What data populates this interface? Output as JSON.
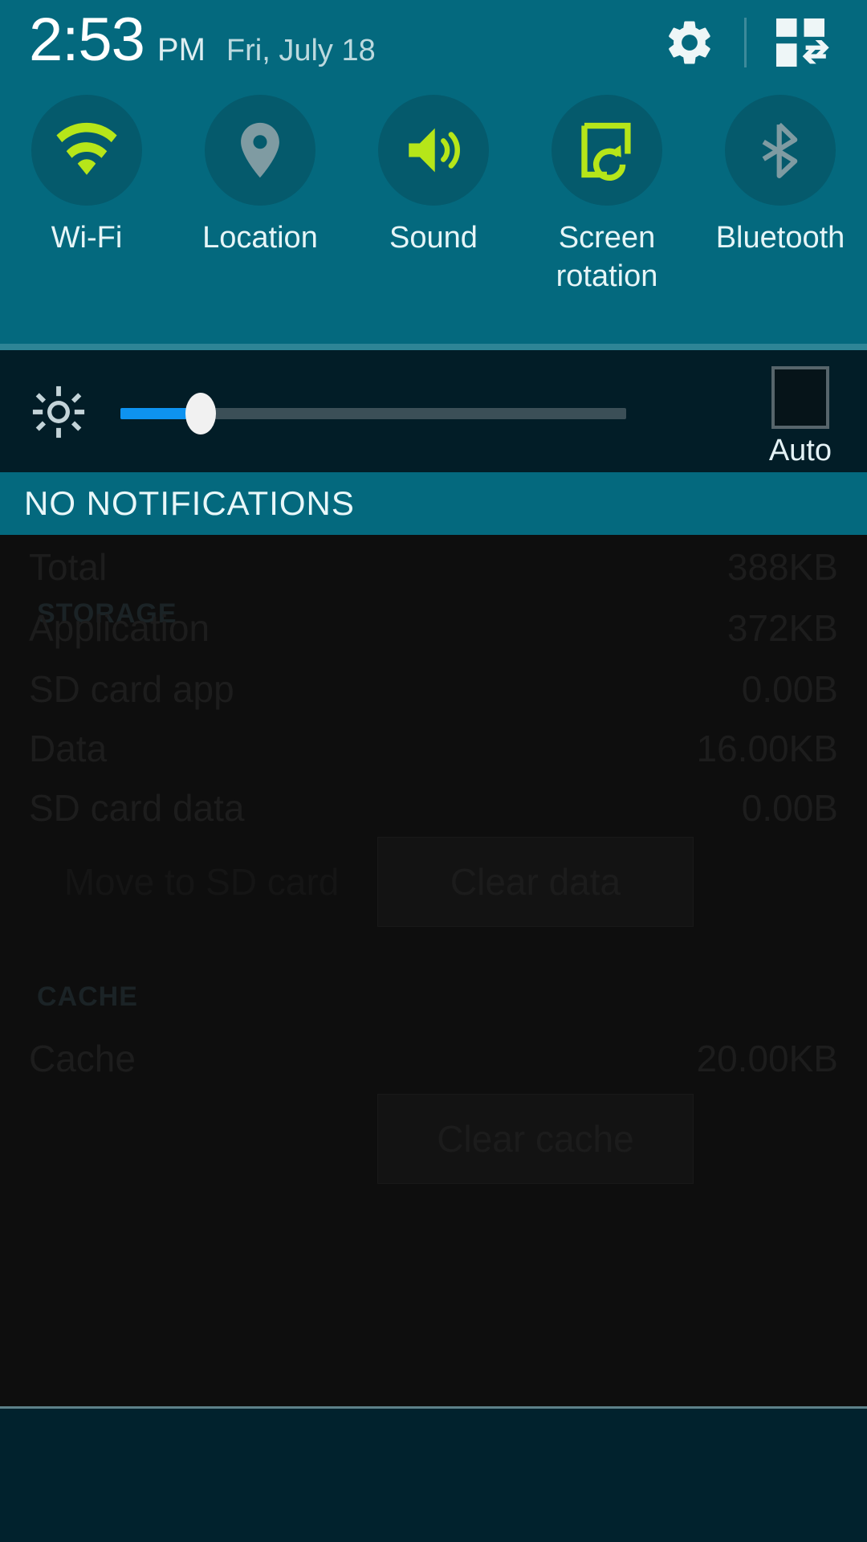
{
  "statusbar": {
    "time": "2:53",
    "ampm": "PM",
    "date": "Fri, July 18",
    "settings_icon": "gear-icon",
    "edit_icon": "quick-settings-grid-icon"
  },
  "quick_toggles": [
    {
      "label": "Wi-Fi",
      "icon": "wifi-icon",
      "state": "on"
    },
    {
      "label": "Location",
      "icon": "location-pin-icon",
      "state": "off"
    },
    {
      "label": "Sound",
      "icon": "sound-speaker-icon",
      "state": "on"
    },
    {
      "label": "Screen\nrotation",
      "label_line1": "Screen",
      "label_line2": "rotation",
      "icon": "screen-rotation-icon",
      "state": "on"
    },
    {
      "label": "Bluetooth",
      "icon": "bluetooth-icon",
      "state": "off"
    }
  ],
  "brightness": {
    "icon": "brightness-gear-icon",
    "value_percent": 15,
    "auto_label": "Auto",
    "auto_checked": false
  },
  "notifications": {
    "header": "NO NOTIFICATIONS"
  },
  "background_app": {
    "storage_section": "STORAGE",
    "storage_rows": [
      {
        "key": "Total",
        "value": "388KB"
      },
      {
        "key": "Application",
        "value": "372KB"
      },
      {
        "key": "SD card app",
        "value": "0.00B"
      },
      {
        "key": "Data",
        "value": "16.00KB"
      },
      {
        "key": "SD card data",
        "value": "0.00B"
      }
    ],
    "move_to_sd_label": "Move to SD card",
    "clear_data_label": "Clear data",
    "cache_section": "CACHE",
    "cache_rows": [
      {
        "key": "Cache",
        "value": "20.00KB"
      }
    ],
    "clear_cache_label": "Clear cache"
  },
  "colors": {
    "header_teal": "#04697e",
    "toggle_circle": "#055a6c",
    "accent_green": "#b6e619",
    "inactive_gray": "#7f9ba2",
    "brightness_panel": "#021d27",
    "slider_blue": "#0e93f0",
    "footer_navy": "#01222d"
  }
}
